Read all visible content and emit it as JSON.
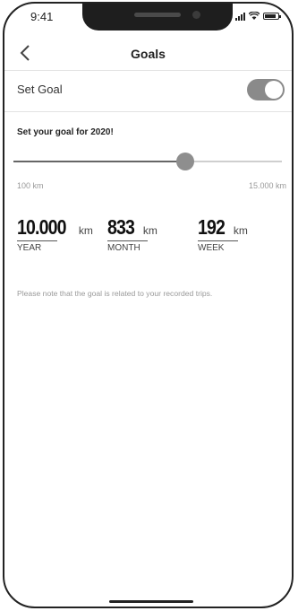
{
  "status_bar": {
    "time": "9:41"
  },
  "nav": {
    "title": "Goals",
    "back_icon": "chevron-left-icon"
  },
  "set_goal": {
    "label": "Set Goal",
    "enabled": true
  },
  "goal_heading": "Set your goal for 2020!",
  "slider": {
    "min_label": "100 km",
    "max_label": "15.000 km",
    "value_fraction": 0.64
  },
  "stats": [
    {
      "value": "10.000",
      "unit": "km",
      "period": "YEAR"
    },
    {
      "value": "833",
      "unit": "km",
      "period": "MONTH"
    },
    {
      "value": "192",
      "unit": "km",
      "period": "WEEK"
    }
  ],
  "note": "Please note that the goal is related to your recorded trips.",
  "colors": {
    "toggle_on": "#8a8a8a",
    "slider_thumb": "#8e8e8e",
    "muted_text": "#999999"
  }
}
